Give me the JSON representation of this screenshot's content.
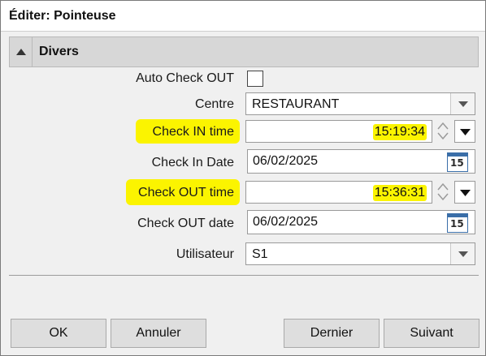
{
  "window": {
    "title": "Éditer: Pointeuse"
  },
  "group": {
    "title": "Divers"
  },
  "fields": {
    "auto_checkout": {
      "label": "Auto Check OUT",
      "checked": false
    },
    "centre": {
      "label": "Centre",
      "value": "RESTAURANT"
    },
    "check_in_time": {
      "label": "Check IN time",
      "value": "15:19:34"
    },
    "check_in_date": {
      "label": "Check In Date",
      "value": "06/02/2025"
    },
    "check_out_time": {
      "label": "Check OUT time",
      "value": "15:36:31"
    },
    "check_out_date": {
      "label": "Check OUT date",
      "value": "06/02/2025"
    },
    "utilisateur": {
      "label": "Utilisateur",
      "value": "S1"
    }
  },
  "calendar_icon_day": "15",
  "buttons": {
    "ok": "OK",
    "cancel": "Annuler",
    "last": "Dernier",
    "next": "Suivant"
  },
  "colors": {
    "highlight": "#fbf400",
    "calendar_accent": "#3a6ea8"
  }
}
